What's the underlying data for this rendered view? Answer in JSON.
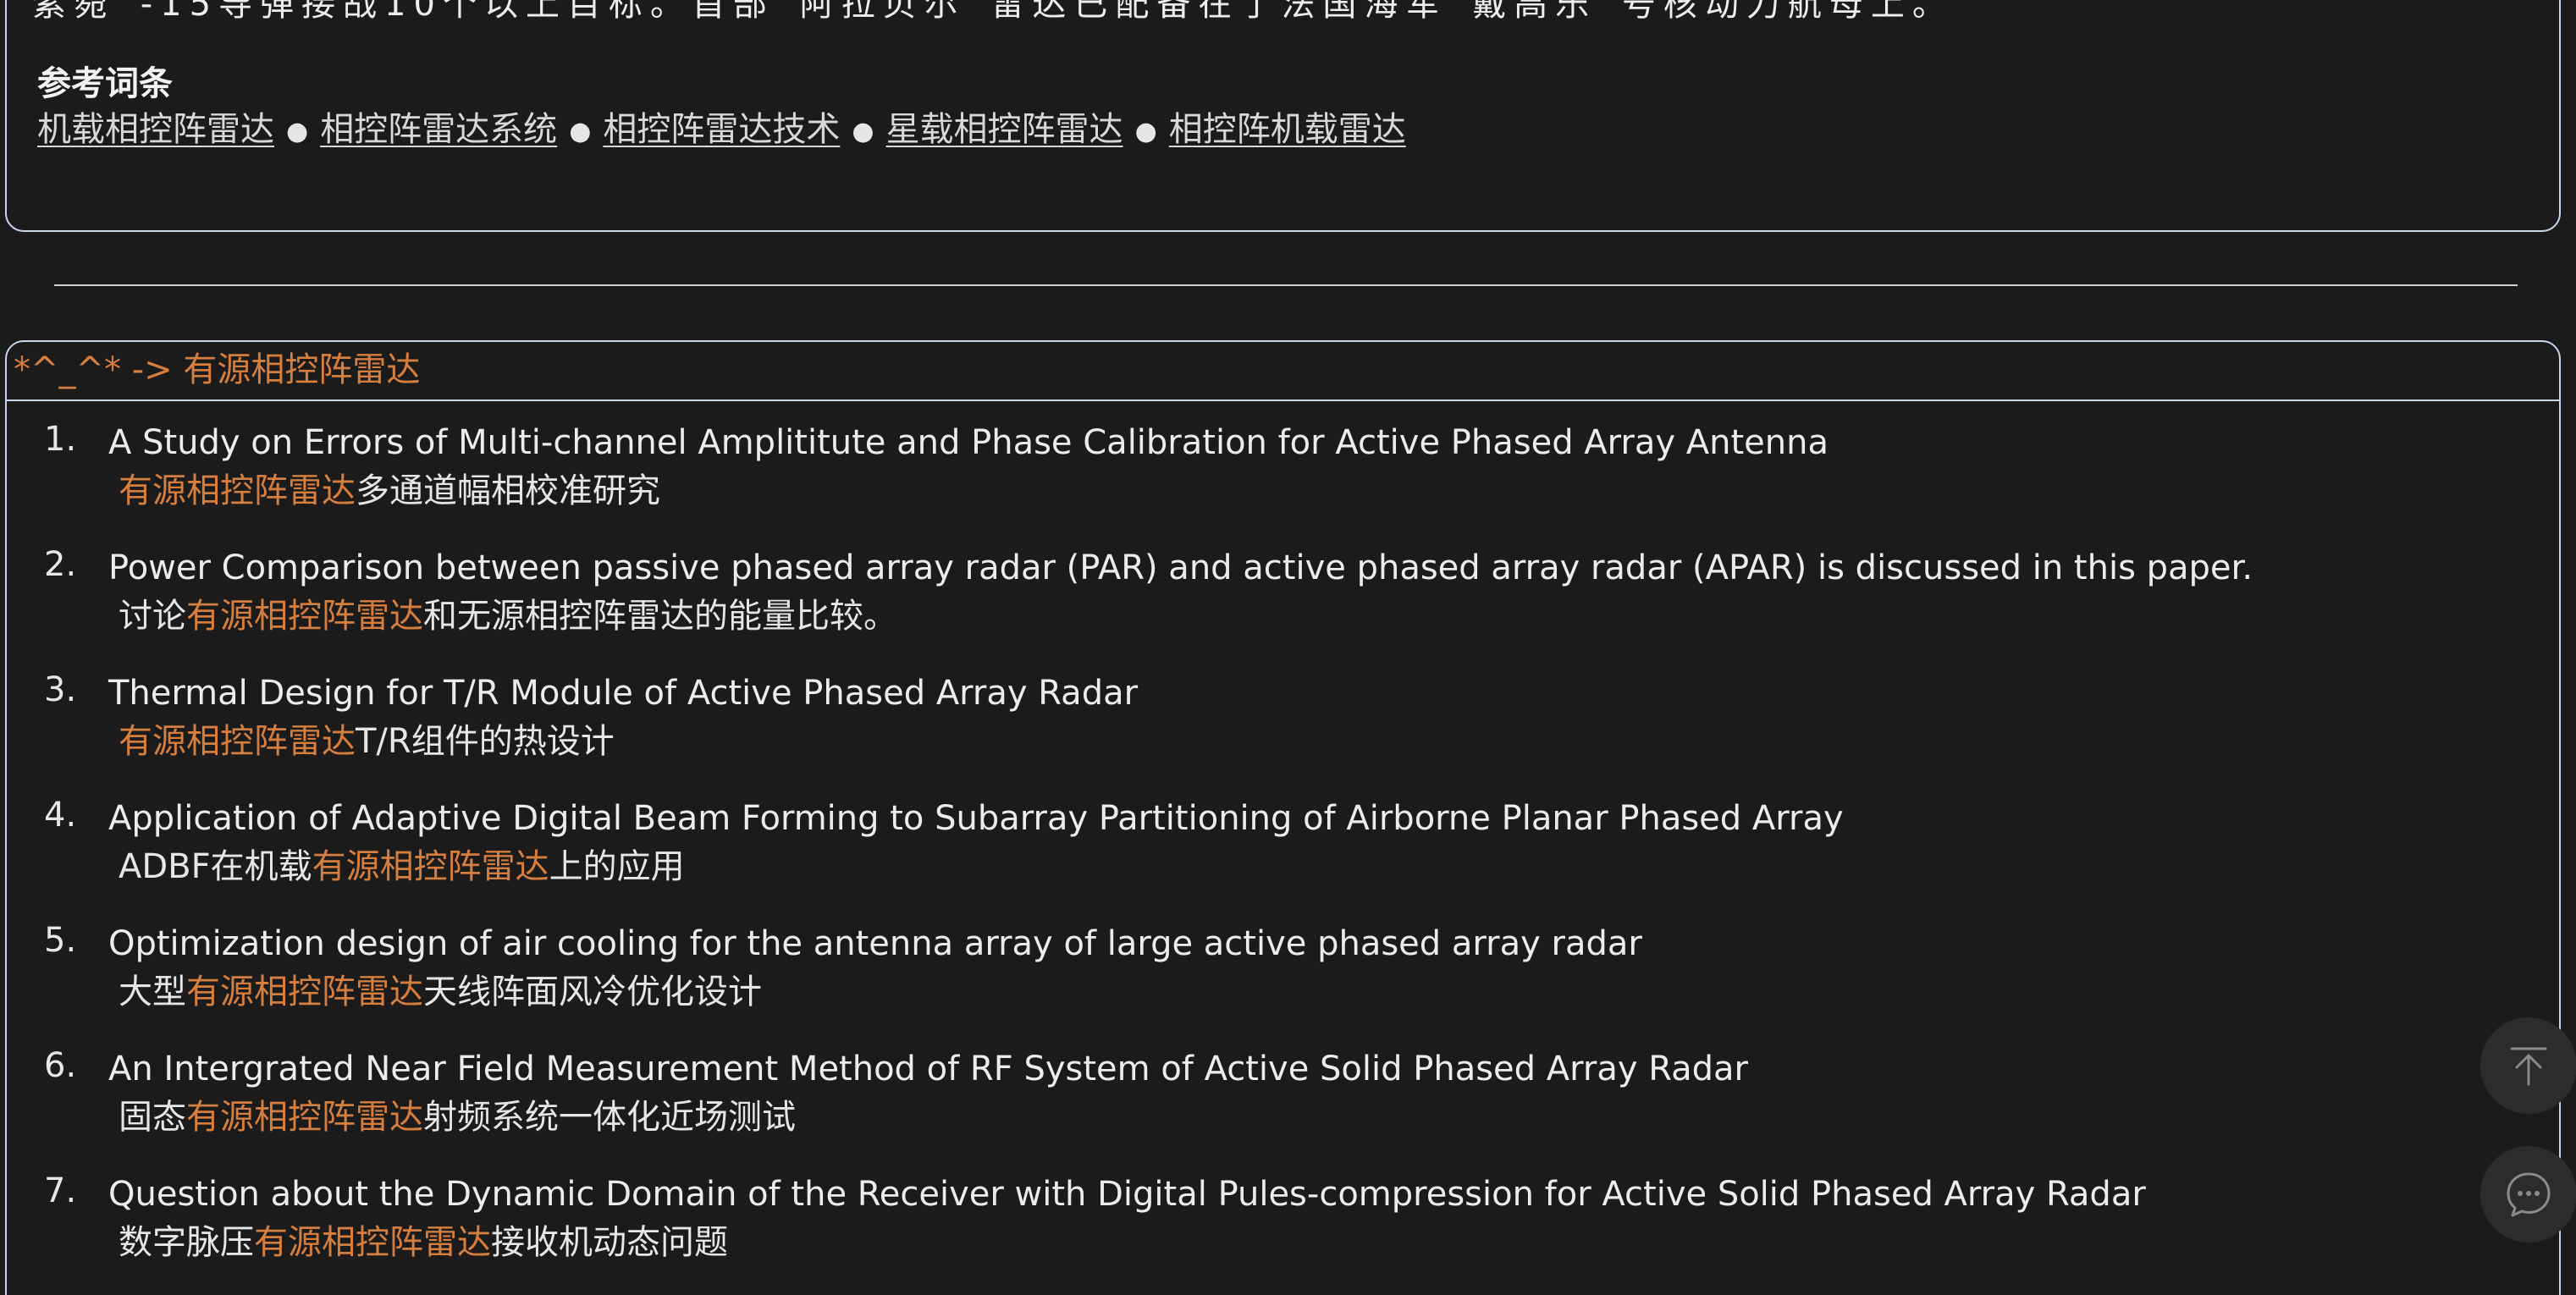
{
  "top_card": {
    "text_line": "紫菀”-15导弹接战10个以上目标。首部“阿拉贝尔”雷达已配备在了法国海军“戴高乐”号核动力航母上。",
    "ref_title": "参考词条",
    "ref_links": [
      "机载相控阵雷达",
      "相控阵雷达系统",
      "相控阵雷达技术",
      "星载相控阵雷达",
      "相控阵机载雷达"
    ],
    "separator": "●"
  },
  "examples": {
    "header": "*^_^* -> 有源相控阵雷达",
    "items": [
      {
        "num": "1.",
        "en": "A Study on Errors of Multi-channel Amplititute and Phase Calibration for Active Phased Array Antenna",
        "zh_pre": "",
        "zh_hl": "有源相控阵雷达",
        "zh_post": "多通道幅相校准研究"
      },
      {
        "num": "2.",
        "en": "Power Comparison between passive phased array radar (PAR) and active phased array radar (APAR) is discussed in this paper.",
        "zh_pre": "讨论",
        "zh_hl": "有源相控阵雷达",
        "zh_post": "和无源相控阵雷达的能量比较。"
      },
      {
        "num": "3.",
        "en": "Thermal Design for T/R Module of Active Phased Array Radar",
        "zh_pre": "",
        "zh_hl": "有源相控阵雷达",
        "zh_post": "T/R组件的热设计"
      },
      {
        "num": "4.",
        "en": "Application of Adaptive Digital Beam Forming to Subarray Partitioning of Airborne Planar Phased Array",
        "zh_pre": "ADBF在机载",
        "zh_hl": "有源相控阵雷达",
        "zh_post": "上的应用"
      },
      {
        "num": "5.",
        "en": "Optimization design of air cooling for the antenna array of large active phased array radar",
        "zh_pre": "大型",
        "zh_hl": "有源相控阵雷达",
        "zh_post": "天线阵面风冷优化设计"
      },
      {
        "num": "6.",
        "en": "An Intergrated Near Field Measurement Method of RF System of Active Solid Phased Array Radar",
        "zh_pre": "固态",
        "zh_hl": "有源相控阵雷达",
        "zh_post": "射频系统一体化近场测试"
      },
      {
        "num": "7.",
        "en": "Question about the Dynamic Domain of the Receiver with Digital Pules-compression for Active Solid Phased Array Radar",
        "zh_pre": "数字脉压",
        "zh_hl": "有源相控阵雷达",
        "zh_post": "接收机动态问题"
      }
    ]
  },
  "icons": {
    "back_to_top": "arrow-up-to-line-icon",
    "chat": "chat-bubble-icon"
  },
  "colors": {
    "background": "#1b1b1b",
    "highlight": "#d67e3e",
    "border": "#c8d6ea",
    "fab": "#2c2c2c"
  }
}
